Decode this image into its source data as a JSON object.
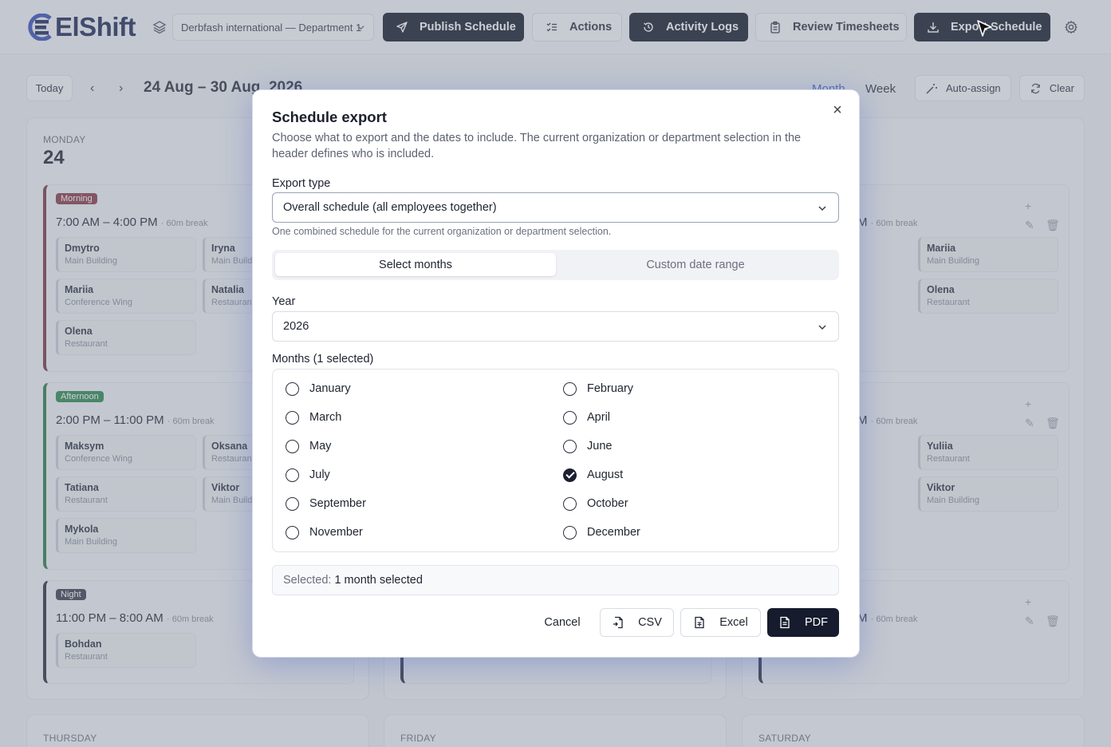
{
  "app": {
    "logo_text": "ElShift",
    "org_select": "Derbfash international — Department 1"
  },
  "toolbar": {
    "publish": "Publish Schedule",
    "actions": "Actions",
    "activity": "Activity Logs",
    "timesheets": "Review Timesheets",
    "export": "Export Schedule"
  },
  "subbar": {
    "today": "Today",
    "prev": "‹",
    "next": "›",
    "range": "24 Aug – 30 Aug, 2026",
    "view_month": "Month",
    "view_week": "Week",
    "auto_assign": "Auto-assign",
    "clear": "Clear"
  },
  "calendar": {
    "day_name": "MONDAY",
    "day_num": "24",
    "shifts": [
      {
        "badge": "Morning",
        "time": "7:00 AM – 4:00 PM",
        "break": "· 60m break",
        "employees": [
          {
            "name": "Dmytro",
            "location": "Main Building"
          },
          {
            "name": "Iryna",
            "location": "Main Building"
          },
          {
            "name": "Mariia",
            "location": "Conference Wing"
          },
          {
            "name": "Natalia",
            "location": "Restaurant"
          },
          {
            "name": "Olena",
            "location": "Restaurant"
          }
        ]
      },
      {
        "badge": "Afternoon",
        "time": "2:00 PM – 11:00 PM",
        "break": "· 60m break",
        "employees": [
          {
            "name": "Maksym",
            "location": "Conference Wing"
          },
          {
            "name": "Oksana",
            "location": "Restaurant"
          },
          {
            "name": "Tatiana",
            "location": "Restaurant"
          },
          {
            "name": "Viktor",
            "location": "Main Building"
          },
          {
            "name": "Mykola",
            "location": "Main Building"
          }
        ]
      },
      {
        "badge": "Night",
        "time": "11:00 PM – 8:00 AM",
        "break": "· 60m break",
        "employees": [
          {
            "name": "Bohdan",
            "location": "Restaurant"
          }
        ]
      }
    ],
    "right_col": {
      "morning_time_tail": "PM",
      "morning_break": "· 60m break",
      "afternoon_time_tail": "PM",
      "afternoon_break": "· 60m break",
      "night_time_tail": "AM",
      "night_break": "· 60m break",
      "morning_emps": [
        {
          "name": "Mariia",
          "location": "Main Building"
        },
        {
          "name": "Olena",
          "location": "Restaurant"
        }
      ],
      "afternoon_emps": [
        {
          "name": "Yuliia",
          "location": "Restaurant"
        },
        {
          "name": "Viktor",
          "location": "Main Building"
        }
      ]
    },
    "row2": [
      "THURSDAY",
      "FRIDAY",
      "SATURDAY"
    ]
  },
  "modal": {
    "title": "Schedule export",
    "description": "Choose what to export and the dates to include. The current organization or department selection in the header defines who is included.",
    "export_type_label": "Export type",
    "export_type_value": "Overall schedule (all employees together)",
    "export_type_help": "One combined schedule for the current organization or department selection.",
    "tabs": {
      "months": "Select months",
      "range": "Custom date range"
    },
    "year_label": "Year",
    "year_value": "2026",
    "months_label": "Months (1 selected)",
    "months": [
      {
        "name": "January",
        "checked": false
      },
      {
        "name": "February",
        "checked": false
      },
      {
        "name": "March",
        "checked": false
      },
      {
        "name": "April",
        "checked": false
      },
      {
        "name": "May",
        "checked": false
      },
      {
        "name": "June",
        "checked": false
      },
      {
        "name": "July",
        "checked": false
      },
      {
        "name": "August",
        "checked": true
      },
      {
        "name": "September",
        "checked": false
      },
      {
        "name": "October",
        "checked": false
      },
      {
        "name": "November",
        "checked": false
      },
      {
        "name": "December",
        "checked": false
      }
    ],
    "summary_key": "Selected:",
    "summary_value": "1 month selected",
    "buttons": {
      "cancel": "Cancel",
      "csv": "CSV",
      "excel": "Excel",
      "pdf": "PDF"
    }
  },
  "colors": {
    "primary_dark": "#161c2d",
    "brand": "#1e2a5a",
    "morning": "#8a3a48",
    "afternoon": "#2e8a52",
    "accent_blue": "#3f68c9"
  }
}
